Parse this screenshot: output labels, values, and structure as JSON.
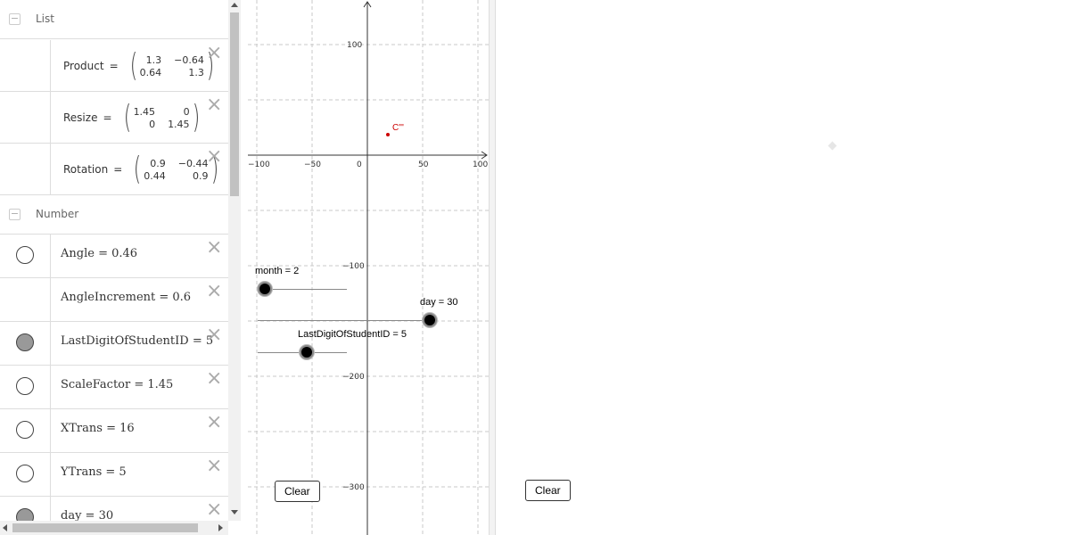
{
  "algebra": {
    "groups": [
      {
        "title": "List",
        "toggle": "−"
      },
      {
        "title": "Number",
        "toggle": "−"
      }
    ],
    "lists": [
      {
        "name": "Product",
        "eq": "=",
        "m": [
          "1.3",
          "−0.64",
          "0.64",
          "1.3"
        ]
      },
      {
        "name": "Resize",
        "eq": "=",
        "m": [
          "1.45",
          "0",
          "0",
          "1.45"
        ]
      },
      {
        "name": "Rotation",
        "eq": "=",
        "m": [
          "0.9",
          "−0.44",
          "0.44",
          "0.9"
        ]
      }
    ],
    "numbers": [
      {
        "text": "Angle = 0.46",
        "marble": "off",
        "deletable": true
      },
      {
        "text": "AngleIncrement = 0.6",
        "marble": "none",
        "deletable": true
      },
      {
        "text": "LastDigitOfStudentID = 5",
        "marble": "on",
        "deletable": true
      },
      {
        "text": "ScaleFactor = 1.45",
        "marble": "off",
        "deletable": true
      },
      {
        "text": "XTrans = 16",
        "marble": "off",
        "deletable": true
      },
      {
        "text": "YTrans = 5",
        "marble": "off",
        "deletable": true
      },
      {
        "text": "day = 30",
        "marble": "on",
        "deletable": true
      }
    ],
    "delete_icon": "×"
  },
  "graphics": {
    "xticks": [
      "−100",
      "−50",
      "0",
      "50",
      "100"
    ],
    "yticks": [
      "100",
      "−100",
      "−200",
      "−300"
    ],
    "point_label": "C'''",
    "point_color": "#cc0000",
    "sliders": [
      {
        "label": "month = 2",
        "value": 2
      },
      {
        "label": "day = 30",
        "value": 30
      },
      {
        "label": "LastDigitOfStudentID = 5",
        "value": 5
      }
    ],
    "clear_label": "Clear"
  },
  "graphics2": {
    "clear_label": "Clear"
  }
}
